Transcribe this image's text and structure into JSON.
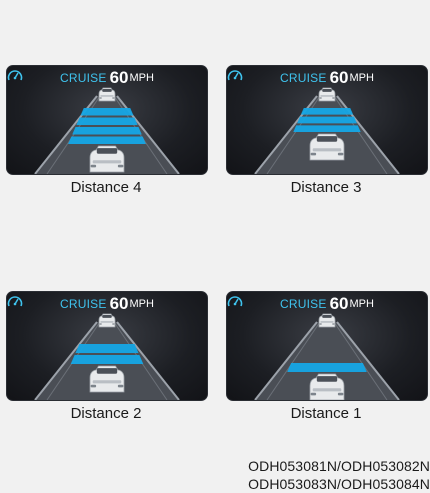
{
  "panels": [
    {
      "cruise_label": "CRUISE",
      "speed": "60",
      "unit": "MPH",
      "caption": "Distance 4",
      "distance_level": 4
    },
    {
      "cruise_label": "CRUISE",
      "speed": "60",
      "unit": "MPH",
      "caption": "Distance 3",
      "distance_level": 3
    },
    {
      "cruise_label": "CRUISE",
      "speed": "60",
      "unit": "MPH",
      "caption": "Distance 2",
      "distance_level": 2
    },
    {
      "cruise_label": "CRUISE",
      "speed": "60",
      "unit": "MPH",
      "caption": "Distance 1",
      "distance_level": 1
    }
  ],
  "codes": {
    "line1": "ODH053081N/ODH053082N",
    "line2": "ODH053083N/ODH053084N"
  },
  "colors": {
    "accent": "#3fc3ee",
    "distance_bar": "#15a7e6",
    "background": "#f1f1f1"
  }
}
